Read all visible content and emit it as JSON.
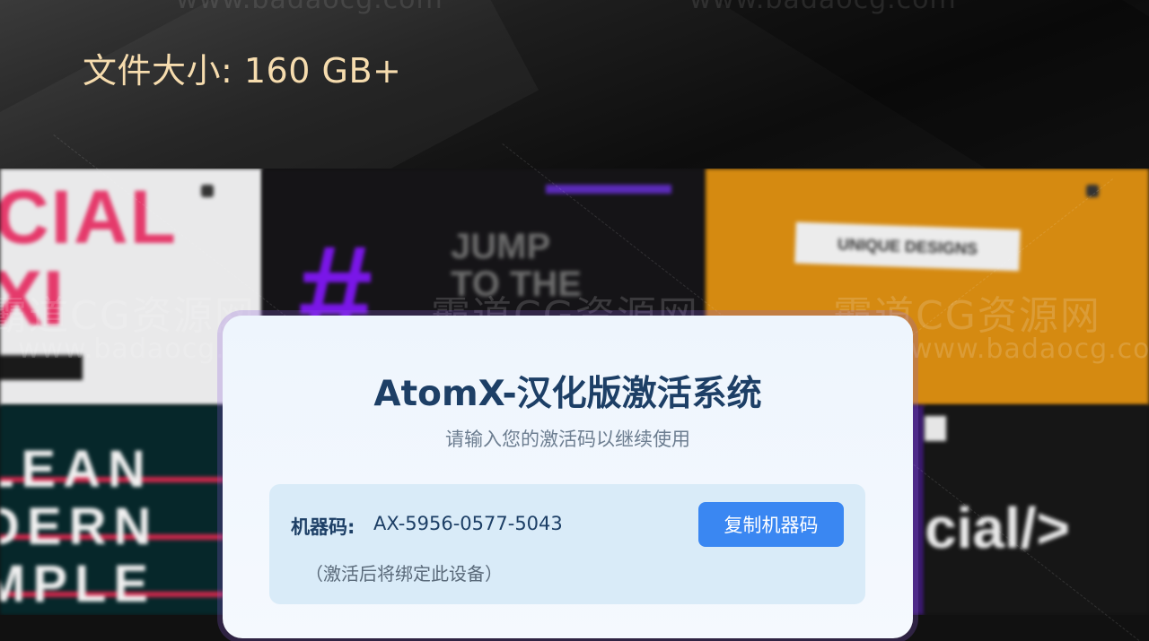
{
  "header": {
    "file_size_text": "文件大小: 160 GB+"
  },
  "watermarks": {
    "url": "www.badaocg.com",
    "site_name": "霸道CG资源网"
  },
  "background_tiles": {
    "tile1_line1": "CIAL",
    "tile1_line2": "XI",
    "tile2_symbol": "#",
    "tile2_line1": "JUMP",
    "tile2_line2": "TO THE",
    "tile3_ribbon": "UNIQUE DESIGNS",
    "tile4_lines": [
      "LEAN",
      "DERN",
      "MPLE"
    ],
    "tile6_text": "cial/>"
  },
  "activation_dialog": {
    "title": "AtomX-汉化版激活系统",
    "subtitle": "请输入您的激活码以继续使用",
    "machine_label": "机器码:",
    "machine_code": "AX-5956-0577-5043",
    "copy_button_label": "复制机器码",
    "bind_note": "（激活后将绑定此设备）"
  },
  "colors": {
    "header_text": "#f6dcae",
    "title_text": "#1d3f66",
    "button_bg": "#3a87f2",
    "machine_box_bg": "#d9ebf8"
  }
}
